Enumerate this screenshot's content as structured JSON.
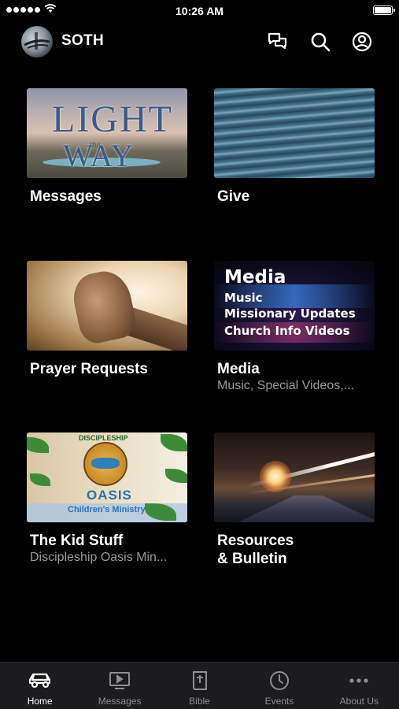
{
  "status_bar": {
    "time": "10:26 AM"
  },
  "header": {
    "app_title": "SOTH",
    "icons": [
      "chat-icon",
      "search-icon",
      "profile-icon"
    ]
  },
  "tiles": [
    {
      "title": "Messages",
      "subtitle": "",
      "thumb_text": [
        "LIGHT",
        "the",
        "WAY"
      ]
    },
    {
      "title": "Give",
      "subtitle": ""
    },
    {
      "title": "Prayer Requests",
      "subtitle": ""
    },
    {
      "title": "Media",
      "subtitle": "Music, Special Videos,...",
      "thumb_text": [
        "Media",
        "Music",
        "Missionary Updates",
        "Church Info Videos"
      ]
    },
    {
      "title": "The Kid Stuff",
      "subtitle": "Discipleship Oasis Min...",
      "thumb_text": [
        "DISCIPLESHIP",
        "OASIS",
        "Children's Ministry"
      ]
    },
    {
      "title": "Resources\n& Bulletin",
      "subtitle": ""
    }
  ],
  "tabbar": {
    "active": "Home",
    "tabs": [
      {
        "label": "Home",
        "icon": "car-icon"
      },
      {
        "label": "Messages",
        "icon": "tv-play-icon"
      },
      {
        "label": "Bible",
        "icon": "bible-icon"
      },
      {
        "label": "Events",
        "icon": "clock-icon"
      },
      {
        "label": "About Us",
        "icon": "more-icon"
      }
    ]
  },
  "colors": {
    "background": "#000000",
    "tabbar_bg": "#1c1c1e",
    "inactive_tab": "#8e8e93",
    "subtitle": "#9a9a9a"
  }
}
